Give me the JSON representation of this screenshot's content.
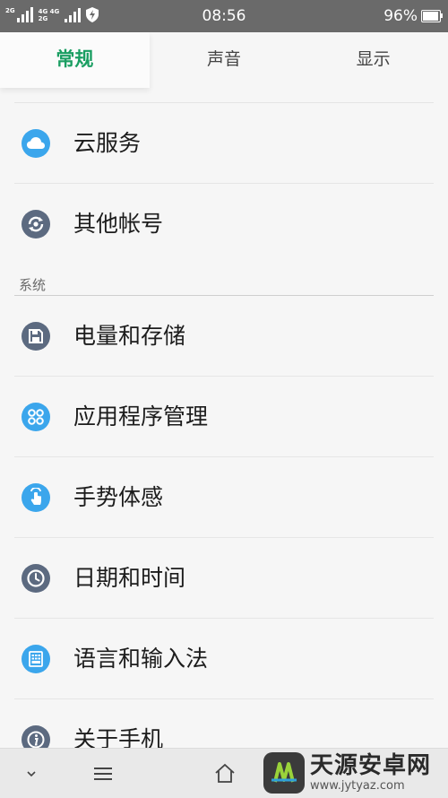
{
  "status_bar": {
    "network_a": "2G",
    "network_b": "4G 4G",
    "network_c": "2G",
    "time": "08:56",
    "battery": "96%",
    "battery_level": 0.96
  },
  "tabs": [
    {
      "label": "常规",
      "active": true
    },
    {
      "label": "声音",
      "active": false
    },
    {
      "label": "显示",
      "active": false
    }
  ],
  "list": {
    "items_top": [
      {
        "label": "云服务",
        "icon": "cloud-icon",
        "color": "#3ba6ec"
      },
      {
        "label": "其他帐号",
        "icon": "account-sync-icon",
        "color": "#5c6a80"
      }
    ],
    "section_system": "系统",
    "items_system": [
      {
        "label": "电量和存储",
        "icon": "save-disk-icon",
        "color": "#5c6a80"
      },
      {
        "label": "应用程序管理",
        "icon": "apps-grid-icon",
        "color": "#3ba6ec"
      },
      {
        "label": "手势体感",
        "icon": "gesture-hand-icon",
        "color": "#3ba6ec"
      },
      {
        "label": "日期和时间",
        "icon": "clock-icon",
        "color": "#5c6a80"
      },
      {
        "label": "语言和输入法",
        "icon": "keyboard-icon",
        "color": "#3ba6ec"
      },
      {
        "label": "关于手机",
        "icon": "info-icon",
        "color": "#5c6a80"
      }
    ]
  },
  "watermark": {
    "title": "天源安卓网",
    "url": "www.jytyaz.com"
  },
  "colors": {
    "accent": "#1a9e62",
    "status_bar": "#6a6a6a"
  }
}
